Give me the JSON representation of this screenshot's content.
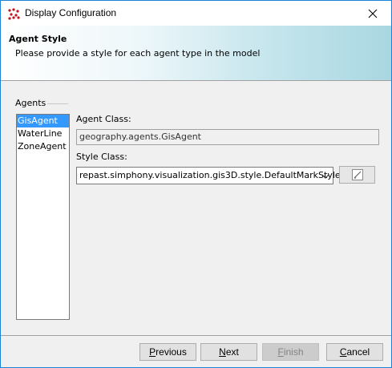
{
  "window": {
    "title": "Display Configuration"
  },
  "banner": {
    "title": "Agent Style",
    "subtitle": "Please provide a style for each agent type in the model"
  },
  "agents": {
    "group_label": "Agents",
    "items": [
      "GisAgent",
      "WaterLine",
      "ZoneAgent"
    ],
    "selected": "GisAgent"
  },
  "form": {
    "agent_class_label": "Agent Class:",
    "agent_class_value": "geography.agents.GisAgent",
    "style_class_label": "Style Class:",
    "style_class_value": "repast.simphony.visualization.gis3D.style.DefaultMarkStyle",
    "edit_icon": "pencil-edit-icon"
  },
  "buttons": {
    "previous": {
      "mnemonic": "P",
      "rest": "revious"
    },
    "next": {
      "mnemonic": "N",
      "rest": "ext"
    },
    "finish": {
      "mnemonic": "F",
      "rest": "inish"
    },
    "cancel": {
      "mnemonic": "C",
      "rest": "ancel"
    }
  },
  "colors": {
    "selection": "#3399ff",
    "window_border": "#1883d7",
    "banner_accent": "#a9d7e1"
  }
}
